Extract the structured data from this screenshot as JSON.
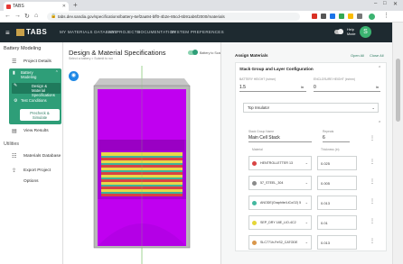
{
  "browser": {
    "tab_title": "TABS",
    "url": "tabs.dev.sandia.gov/specifications/battery-6ef2aa94-bff0-4b2e-85cd-6b91ab6f2000/materials"
  },
  "header": {
    "logo": "TABS",
    "nav": [
      "MY MATERIALS DATABASE",
      "MY PROJECTS",
      "DOCUMENTATION",
      "SYSTEM PREFERENCES"
    ],
    "help_line1": "Help",
    "help_line2": "Mode",
    "avatar": "S"
  },
  "sidebar": {
    "title": "Battery Modeling",
    "project_details": "Project Details",
    "battery_line1": "Battery",
    "battery_line2": "Modeling",
    "design_line1": "Design & Material",
    "design_line2": "Specifications",
    "test_conditions": "Test Conditions",
    "precheck_line1": "Precheck &",
    "precheck_line2": "Simulate",
    "view_results": "View Results",
    "utilities": "Utilities",
    "materials_database": "Materials Database",
    "export_options": "Export Project Options"
  },
  "center": {
    "title": "Design & Material Specifications",
    "subtitle": "Select a battery > Submit to run",
    "battery_to_scale": "Battery to Scale"
  },
  "right": {
    "title": "Assign Materials",
    "open_all": "Open All",
    "close_all": "Close All",
    "stack_title": "Stack Group and Layer Configuration",
    "label_a": "BATTERY HEIGHT (in/mm)",
    "value_a": "1.5",
    "label_b": "ENCLOSURE HEIGHT (in/mm)",
    "value_b": "0",
    "dropdown": "Top Insulator",
    "stack_name_label": "Stack Group Name",
    "stack_name": "Main Cell Stack",
    "repeats_label": "Repeats",
    "repeats": "6",
    "material_header": "Material",
    "thickness_header": "Thickness (in)",
    "materials": [
      {
        "name": "HENTROLLETTER 13",
        "thickness": "0.025",
        "color": "#d84343"
      },
      {
        "name": "57_STEEL_304",
        "thickness": "0.005",
        "color": "#8a8a8a"
      },
      {
        "name": "ANODE(Graphite/LiCoO2) 5",
        "thickness": "0.013",
        "color": "#43b8a0"
      },
      {
        "name": "SEP_DRY 18E_LIO-4C2",
        "thickness": "0.01",
        "color": "#e5d638"
      },
      {
        "name": "SLC771h-FeS2_CATODE",
        "thickness": "0.013",
        "color": "#d9964a"
      }
    ]
  }
}
